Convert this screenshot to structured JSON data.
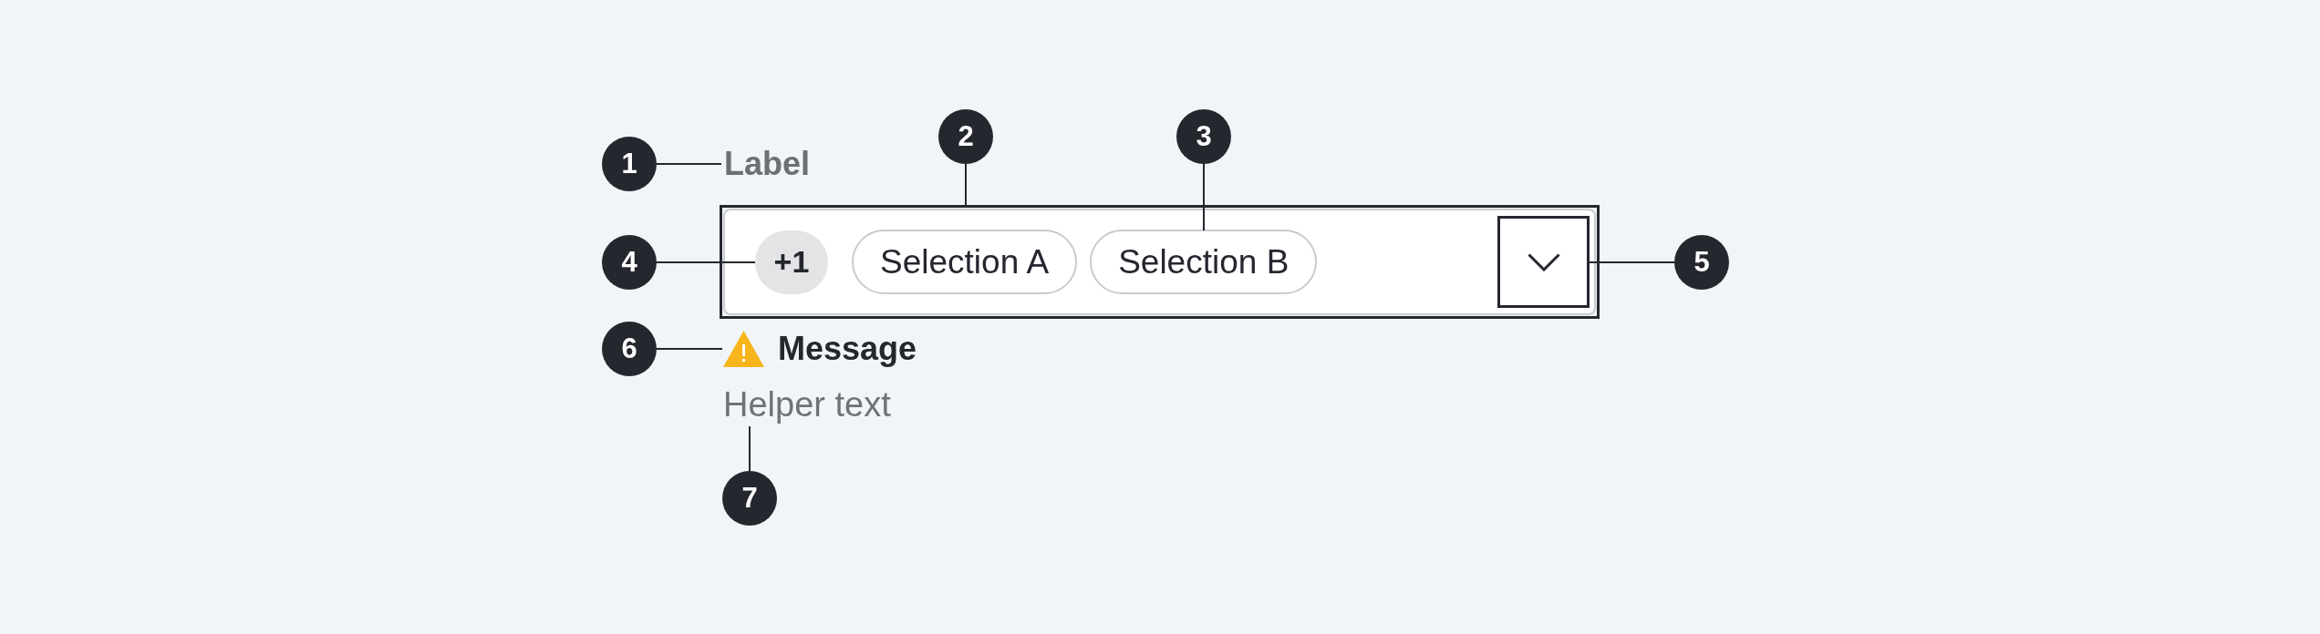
{
  "label": {
    "text": "Label",
    "callout": "1"
  },
  "field": {
    "callout": "2",
    "overflow": {
      "text": "+1",
      "callout": "4"
    },
    "chips": [
      {
        "label": "Selection A"
      },
      {
        "label": "Selection B",
        "callout": "3"
      }
    ],
    "dropdown_button": {
      "callout": "5"
    }
  },
  "message": {
    "kind": "warning",
    "text": "Message",
    "callout": "6"
  },
  "helper_text": {
    "text": "Helper text",
    "callout": "7"
  }
}
